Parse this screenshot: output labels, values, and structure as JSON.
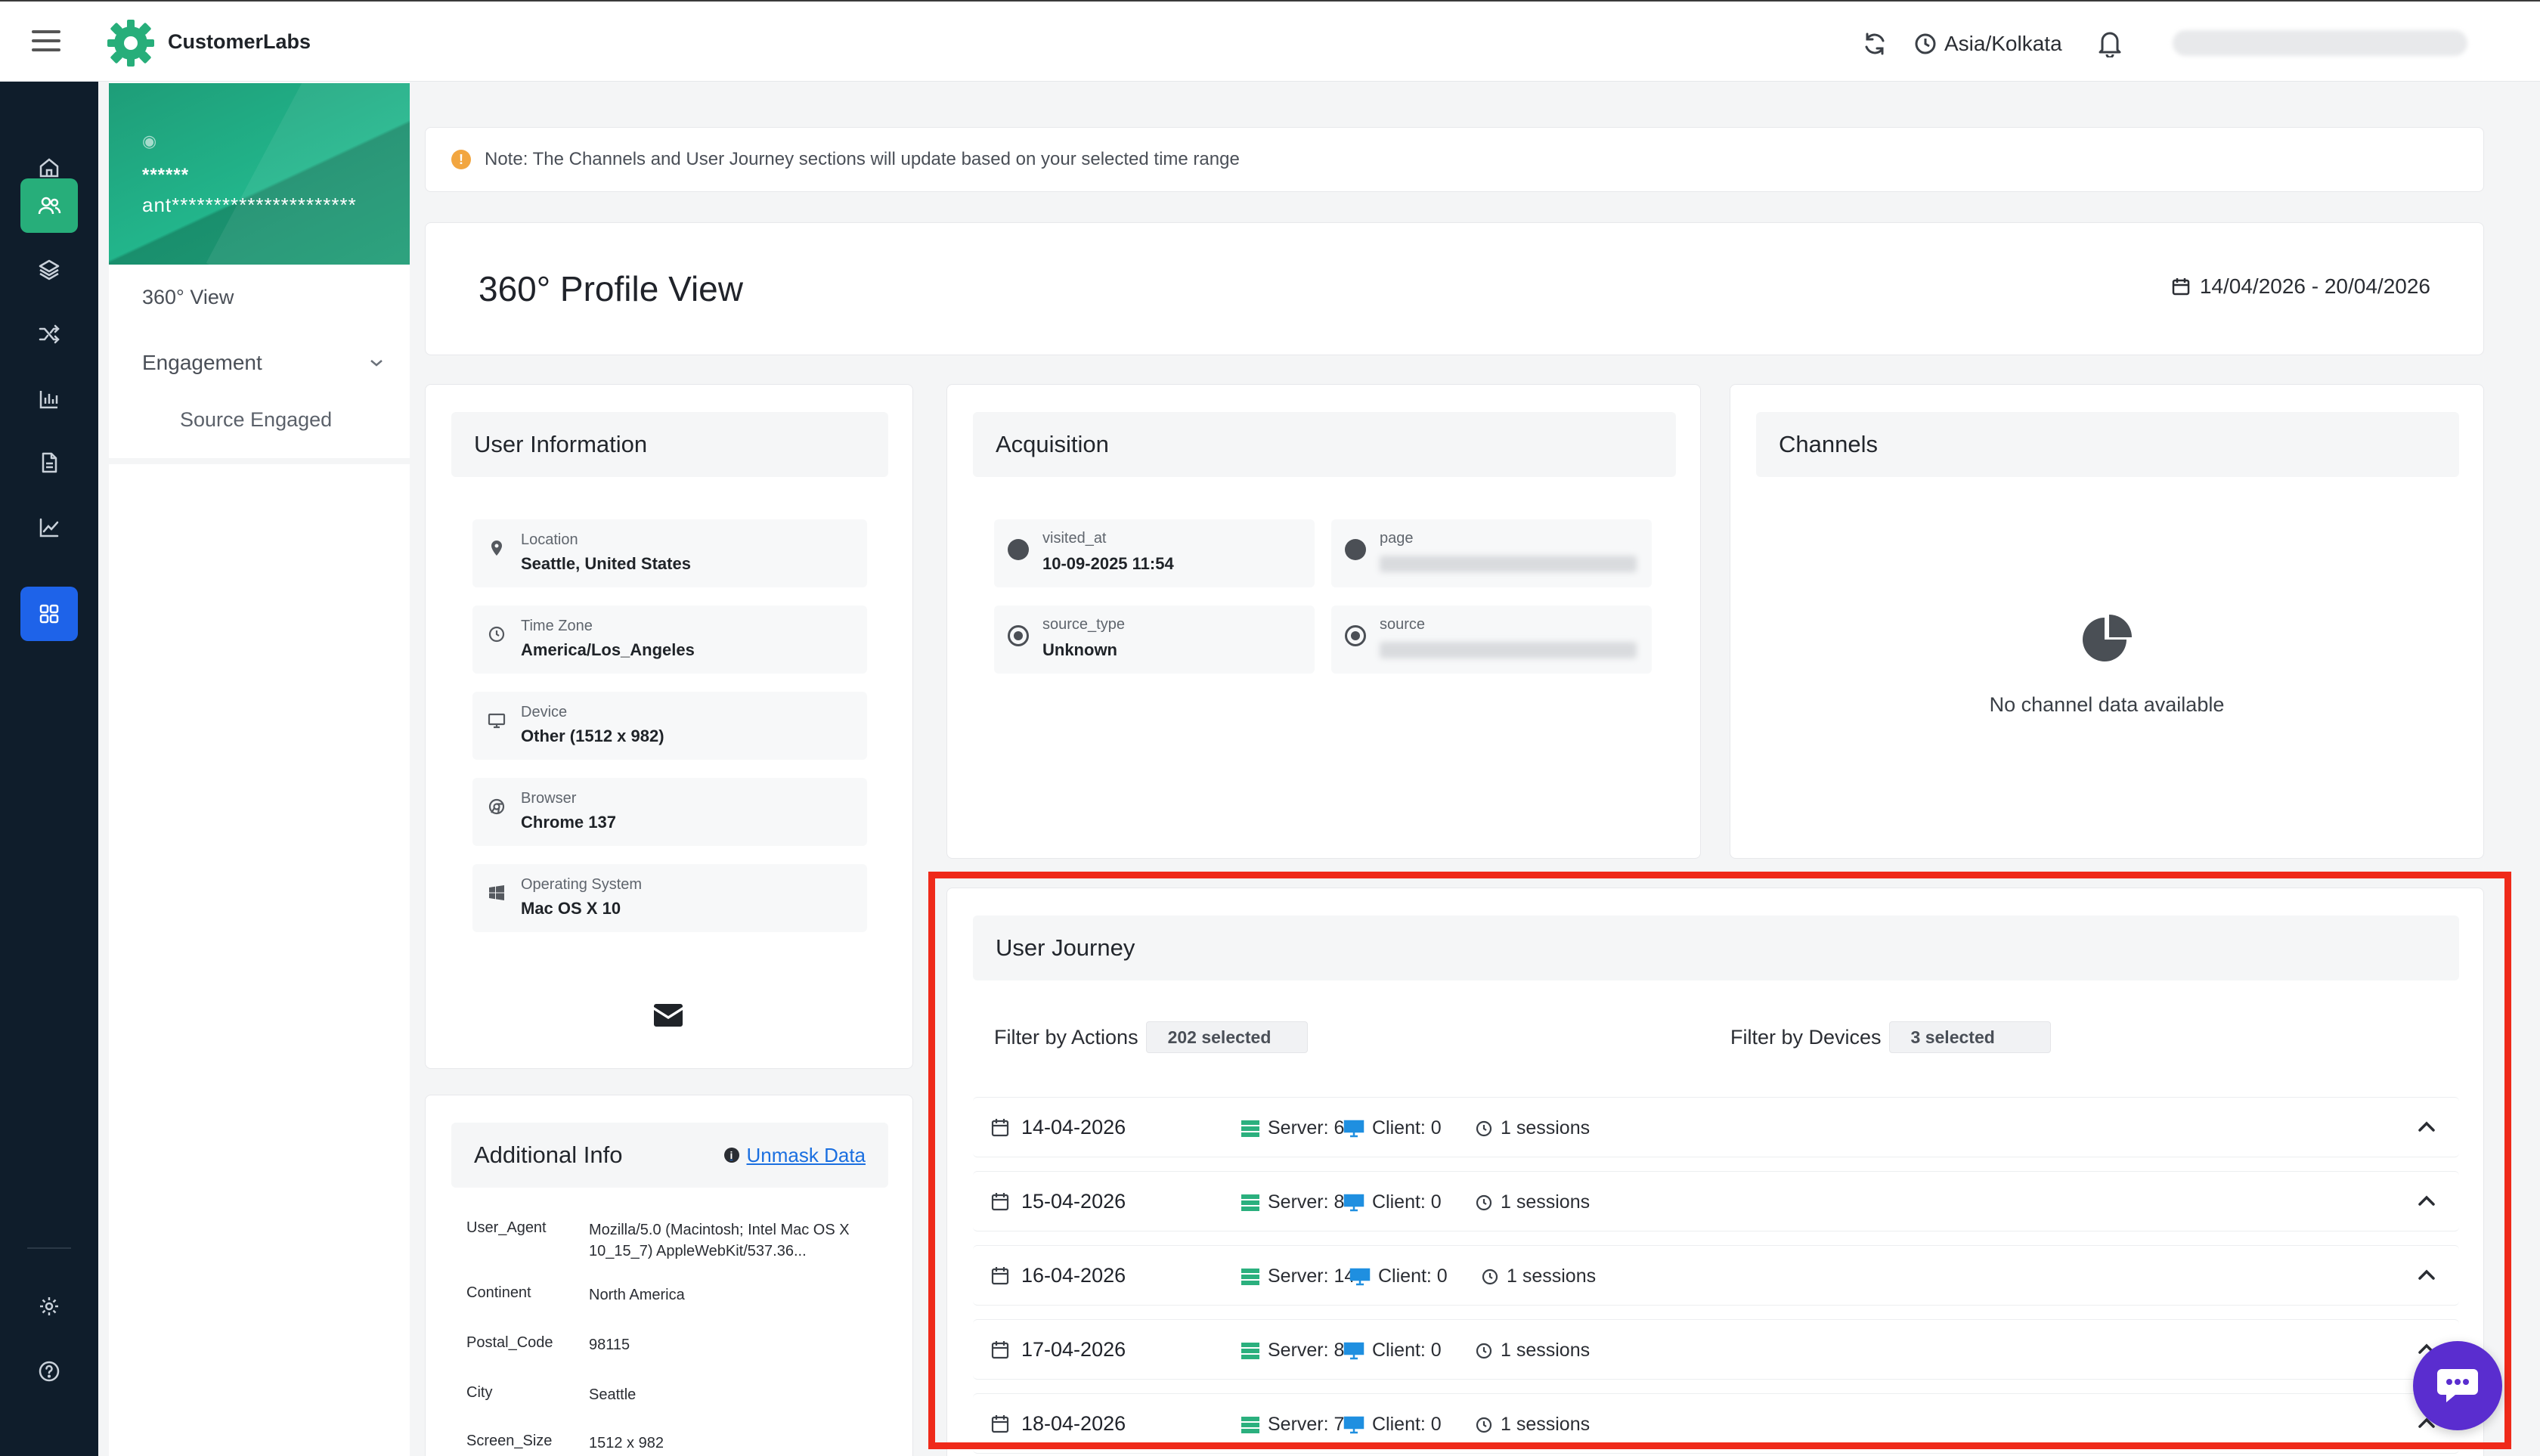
{
  "app": {
    "name": "CustomerLabs",
    "brand_color": "#27ae7a"
  },
  "topbar": {
    "timezone": "Asia/Kolkata",
    "icons": [
      "hamburger-icon",
      "refresh-icon",
      "clock-icon",
      "bell-icon"
    ]
  },
  "rail": {
    "items": [
      "home-icon",
      "users-icon",
      "layers-icon",
      "shuffle-icon",
      "bar-chart-icon",
      "document-icon",
      "line-chart-icon",
      "grid-icon",
      "settings-icon",
      "help-icon"
    ]
  },
  "profile": {
    "name_masked": "******",
    "email_masked": "ant**********************"
  },
  "subnav": {
    "view": "360° View",
    "section": "Engagement",
    "child": "Source Engaged"
  },
  "note": "Note: The Channels and User Journey sections will update based on your selected time range",
  "header": {
    "title": "360° Profile View",
    "date_range": "14/04/2026 - 20/04/2026"
  },
  "user_info": {
    "title": "User Information",
    "rows": [
      {
        "label": "Location",
        "value": "Seattle, United States",
        "icon": "location-pin-icon"
      },
      {
        "label": "Time Zone",
        "value": "America/Los_Angeles",
        "icon": "clock-icon"
      },
      {
        "label": "Device",
        "value": "Other (1512 x 982)",
        "icon": "monitor-icon"
      },
      {
        "label": "Browser",
        "value": "Chrome 137",
        "icon": "chrome-icon"
      },
      {
        "label": "Operating System",
        "value": "Mac OS X 10",
        "icon": "windows-icon"
      }
    ]
  },
  "additional_info": {
    "title": "Additional Info",
    "unmask_label": "Unmask Data",
    "rows": [
      {
        "key": "User_Agent",
        "value": "Mozilla/5.0 (Macintosh; Intel Mac OS X 10_15_7) AppleWebKit/537.36..."
      },
      {
        "key": "Continent",
        "value": "North America"
      },
      {
        "key": "Postal_Code",
        "value": "98115"
      },
      {
        "key": "City",
        "value": "Seattle"
      },
      {
        "key": "Screen_Size",
        "value": "1512 x 982"
      }
    ]
  },
  "acquisition": {
    "title": "Acquisition",
    "cells": [
      {
        "label": "visited_at",
        "value": "10-09-2025 11:54"
      },
      {
        "label": "page",
        "value": ""
      },
      {
        "label": "source_type",
        "value": "Unknown"
      },
      {
        "label": "source",
        "value": ""
      }
    ]
  },
  "channels": {
    "title": "Channels",
    "empty": "No channel data available"
  },
  "journey": {
    "title": "User Journey",
    "filter_actions_label": "Filter by Actions",
    "filter_actions_value": "202 selected",
    "filter_devices_label": "Filter by Devices",
    "filter_devices_value": "3 selected",
    "rows": [
      {
        "date": "14-04-2026",
        "server": "Server: 6",
        "client": "Client: 0",
        "sessions": "1 sessions"
      },
      {
        "date": "15-04-2026",
        "server": "Server: 8",
        "client": "Client: 0",
        "sessions": "1 sessions"
      },
      {
        "date": "16-04-2026",
        "server": "Server: 14",
        "client": "Client: 0",
        "sessions": "1 sessions"
      },
      {
        "date": "17-04-2026",
        "server": "Server: 8",
        "client": "Client: 0",
        "sessions": "1 sessions"
      },
      {
        "date": "18-04-2026",
        "server": "Server: 7",
        "client": "Client: 0",
        "sessions": "1 sessions"
      }
    ]
  },
  "colors": {
    "rail_bg": "#0f1d2b",
    "active_blue": "#1e63e9",
    "highlight": "#ef2a1a",
    "chat": "#5a2dcf"
  }
}
